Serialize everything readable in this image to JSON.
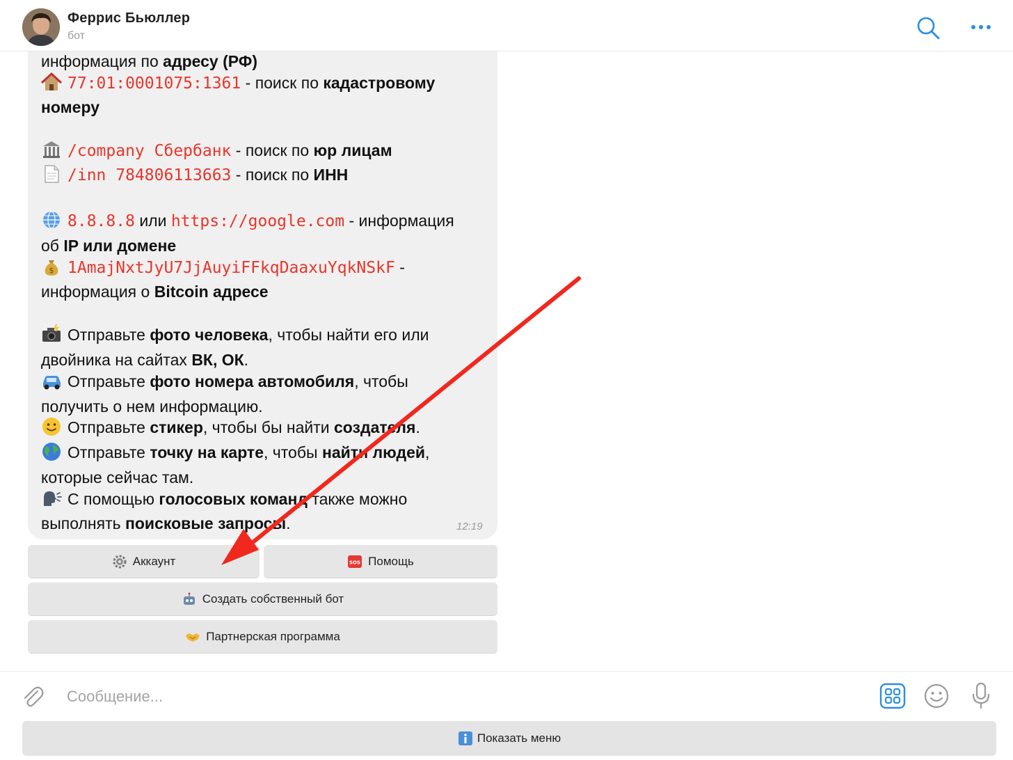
{
  "header": {
    "title": "Феррис Бьюллер",
    "status": "бот"
  },
  "message": {
    "time": "12:19",
    "lines": {
      "l1_a": "информация по ",
      "l1_b": "адресу (РФ)",
      "l2_code": "77:01:0001075:1361",
      "l2_a": " - поиск по ",
      "l2_b": "кадастровому",
      "l3_b": "номеру",
      "l4_code": "/company Сбербанк",
      "l4_a": " - поиск по ",
      "l4_b": "юр лицам",
      "l5_code": "/inn 784806113663",
      "l5_a": " - поиск по ",
      "l5_b": "ИНН",
      "l6_code1": "8.8.8.8",
      "l6_a": " или ",
      "l6_code2": "https://google.com",
      "l6_c": " - информация",
      "l7_a": "об ",
      "l7_b": "IP или домене",
      "l8_code": "1AmajNxtJyU7JjAuyiFFkqDaaxuYqkNSkF",
      "l8_a": " -",
      "l9_a": "информация о ",
      "l9_b": "Bitcoin адресе",
      "l10_a": "Отправьте ",
      "l10_b": "фото человека",
      "l10_c": ", чтобы найти его или",
      "l11_a": "двойника на сайтах ",
      "l11_b": "ВК, ОК",
      "l11_c": ".",
      "l12_a": "Отправьте ",
      "l12_b": "фото номера автомобиля",
      "l12_c": ", чтобы",
      "l13_a": "получить о нем информацию.",
      "l14_a": "Отправьте ",
      "l14_b": "стикер",
      "l14_c": ", чтобы бы найти ",
      "l14_d": "создателя",
      "l14_e": ".",
      "l15_a": "Отправьте ",
      "l15_b": "точку на карте",
      "l15_c": ", чтобы ",
      "l15_d": "найти людей",
      "l15_e": ",",
      "l16_a": "которые сейчас там.",
      "l17_a": "С помощью ",
      "l17_b": "голосовых команд",
      "l17_c": " также можно",
      "l18_a": "выполнять ",
      "l18_b": "поисковые запросы",
      "l18_c": "."
    }
  },
  "keyboard": {
    "account": "Аккаунт",
    "help": "Помощь",
    "help_badge": "SOS",
    "create_bot": "Создать собственный бот",
    "partner": "Партнерская программа"
  },
  "composer": {
    "placeholder": "Сообщение..."
  },
  "menu": {
    "label": "Показать меню"
  },
  "colors": {
    "code": "#e8352b",
    "accent": "#2a8ee0",
    "arrow": "#f0281e"
  }
}
